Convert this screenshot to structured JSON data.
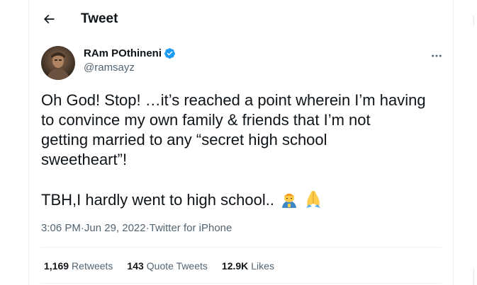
{
  "header": {
    "title": "Tweet",
    "back_icon": "arrow-left-icon"
  },
  "author": {
    "display_name": "RAm POthineni",
    "handle": "@ramsayz",
    "verified": true,
    "verified_color": "#1d9bf0"
  },
  "tweet": {
    "lines": [
      "Oh God! Stop! …it’s reached a point wherein I’m having",
      "to convince my own family & friends that I’m not",
      "getting married to any “secret high school",
      "sweetheart”!"
    ],
    "last_line": "TBH,I hardly went to high school..",
    "emojis": [
      "man-bowing-emoji",
      "folded-hands-emoji"
    ]
  },
  "meta": {
    "time": "3:06 PM",
    "separator": " · ",
    "date": "Jun 29, 2022",
    "source": "Twitter for iPhone"
  },
  "stats": {
    "retweets_count": "1,169",
    "retweets_label": "Retweets",
    "quotes_count": "143",
    "quotes_label": "Quote Tweets",
    "likes_count": "12.9K",
    "likes_label": "Likes"
  },
  "colors": {
    "text": "#0f1419",
    "secondary": "#536471",
    "divider": "#eff3f4",
    "accent": "#1d9bf0"
  }
}
